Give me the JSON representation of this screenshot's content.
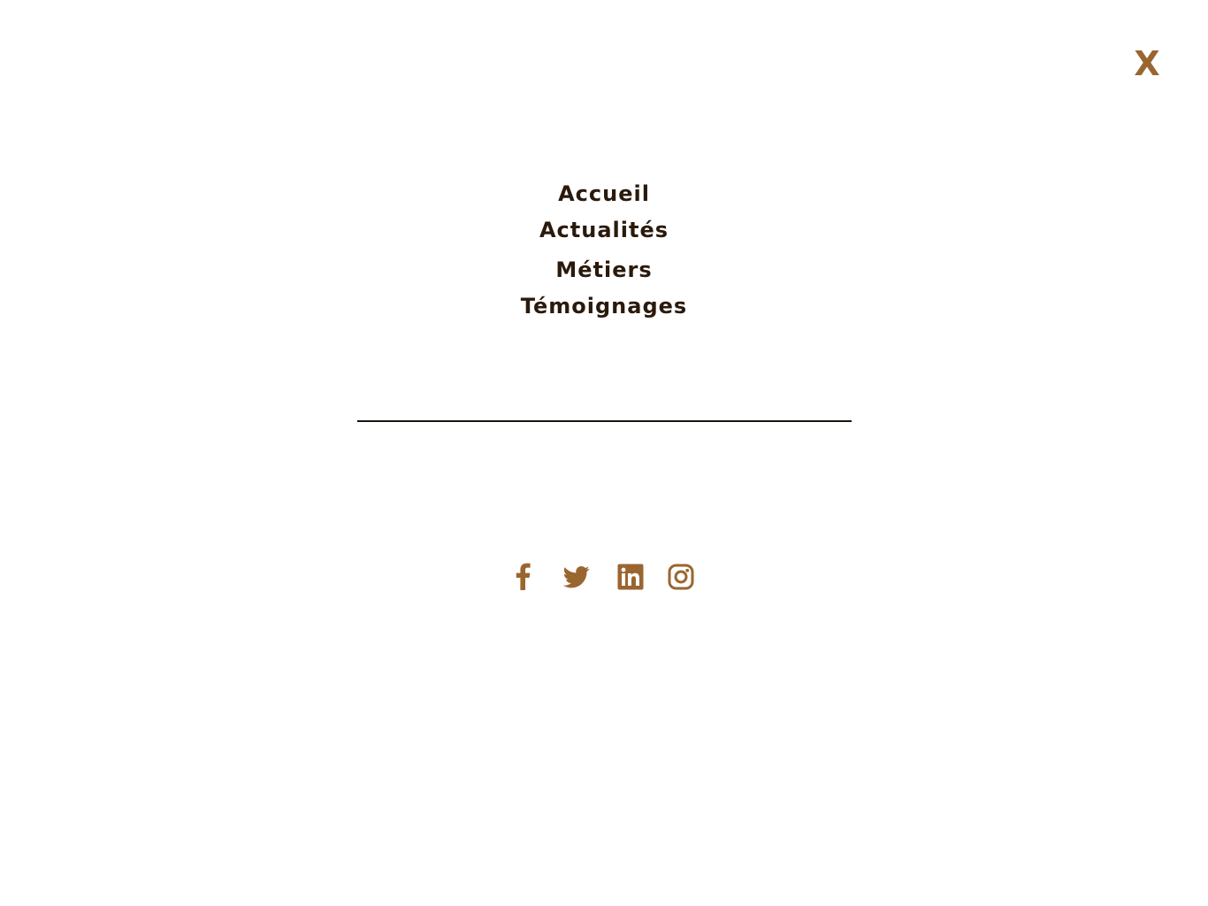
{
  "close_button": {
    "label": "X"
  },
  "nav": {
    "items": [
      {
        "label": "Accueil"
      },
      {
        "label": "Actualités"
      },
      {
        "label": "Métiers"
      },
      {
        "label": "Témoignages"
      }
    ]
  },
  "social": {
    "icons": [
      "facebook-icon",
      "twitter-icon",
      "linkedin-icon",
      "instagram-icon"
    ]
  },
  "colors": {
    "accent": "#9a6630",
    "text": "#2a1a0c",
    "divider": "#1d130b",
    "background": "#ffffff"
  }
}
